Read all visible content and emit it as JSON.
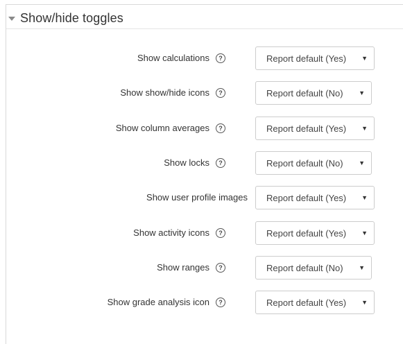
{
  "section": {
    "title": "Show/hide toggles"
  },
  "rows": [
    {
      "label": "Show calculations",
      "has_help": true,
      "value": "Report default (Yes)"
    },
    {
      "label": "Show show/hide icons",
      "has_help": true,
      "value": "Report default (No)"
    },
    {
      "label": "Show column averages",
      "has_help": true,
      "value": "Report default (Yes)"
    },
    {
      "label": "Show locks",
      "has_help": true,
      "value": "Report default (No)"
    },
    {
      "label": "Show user profile images",
      "has_help": false,
      "value": "Report default (Yes)"
    },
    {
      "label": "Show activity icons",
      "has_help": true,
      "value": "Report default (Yes)"
    },
    {
      "label": "Show ranges",
      "has_help": true,
      "value": "Report default (No)"
    },
    {
      "label": "Show grade analysis icon",
      "has_help": true,
      "value": "Report default (Yes)"
    }
  ],
  "icons": {
    "help": "question-circle-icon",
    "dropdown": "caret-down-icon",
    "collapse": "caret-down-icon"
  },
  "glyphs": {
    "help": "?",
    "dropdown": "▼"
  }
}
